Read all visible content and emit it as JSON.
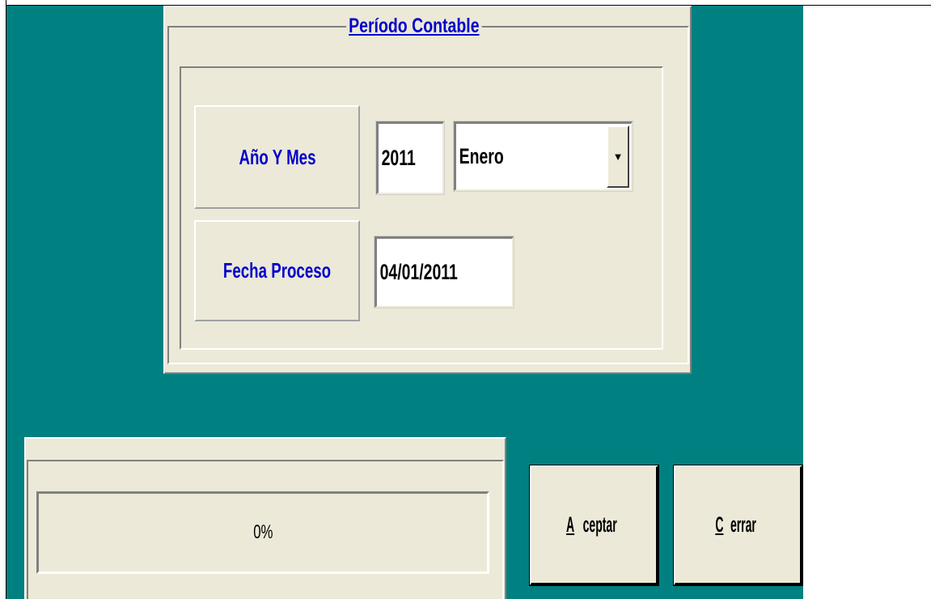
{
  "colors": {
    "background": "#008080",
    "panel": "#ece9d8",
    "label_text": "#0000cc"
  },
  "periodo": {
    "title": "Período Contable",
    "anio_mes_label": "Año Y Mes",
    "anio_value": "2011",
    "mes_value": "Enero",
    "fecha_label": "Fecha Proceso",
    "fecha_value": "04/01/2011"
  },
  "progress": {
    "text": "0%",
    "percent": 0
  },
  "buttons": {
    "aceptar": {
      "first": "A",
      "rest": "ceptar"
    },
    "cerrar": {
      "first": "C",
      "rest": "errar"
    }
  },
  "icons": {
    "dropdown": "chevron-down-icon"
  }
}
